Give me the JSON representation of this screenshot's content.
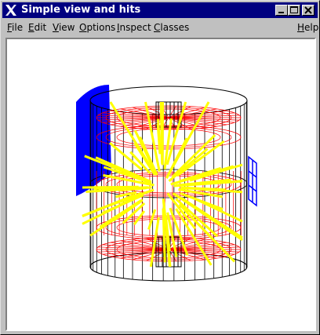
{
  "window": {
    "title": "Simple view and hits",
    "controls": [
      "minimize",
      "maximize",
      "close"
    ]
  },
  "menubar": {
    "items": [
      "File",
      "Edit",
      "View",
      "Options",
      "Inspect",
      "Classes"
    ],
    "help": "Help"
  },
  "viewport": {
    "content": "3D detector wireframe with particle tracks",
    "colors": {
      "background": "#ffffff",
      "detector_outer": "#000000",
      "detector_inner": "#ff0000",
      "tracks": "#ffff00",
      "endcap_left": "#0000ff",
      "endcap_right": "#0000ff"
    }
  }
}
